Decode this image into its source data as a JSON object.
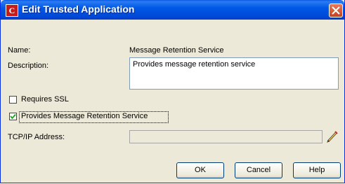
{
  "window": {
    "title": "Edit Trusted Application",
    "app_icon_glyph": "C",
    "accent_color": "#0058e6",
    "close_color": "#c4421d"
  },
  "form": {
    "name_label": "Name:",
    "name_value": "Message Retention Service",
    "description_label": "Description:",
    "description_value": "Provides message retention service",
    "requires_ssl": {
      "label": "Requires SSL",
      "checked": false
    },
    "provides_mrs": {
      "label": "Provides Message Retention Service",
      "checked": true
    },
    "tcpip_label": "TCP/IP Address:",
    "tcpip_value": ""
  },
  "buttons": {
    "ok": "OK",
    "cancel": "Cancel",
    "help": "Help"
  },
  "icons": {
    "title": "app-icon",
    "close": "close-icon",
    "edit": "pencil-icon",
    "check": "checkmark-icon"
  }
}
